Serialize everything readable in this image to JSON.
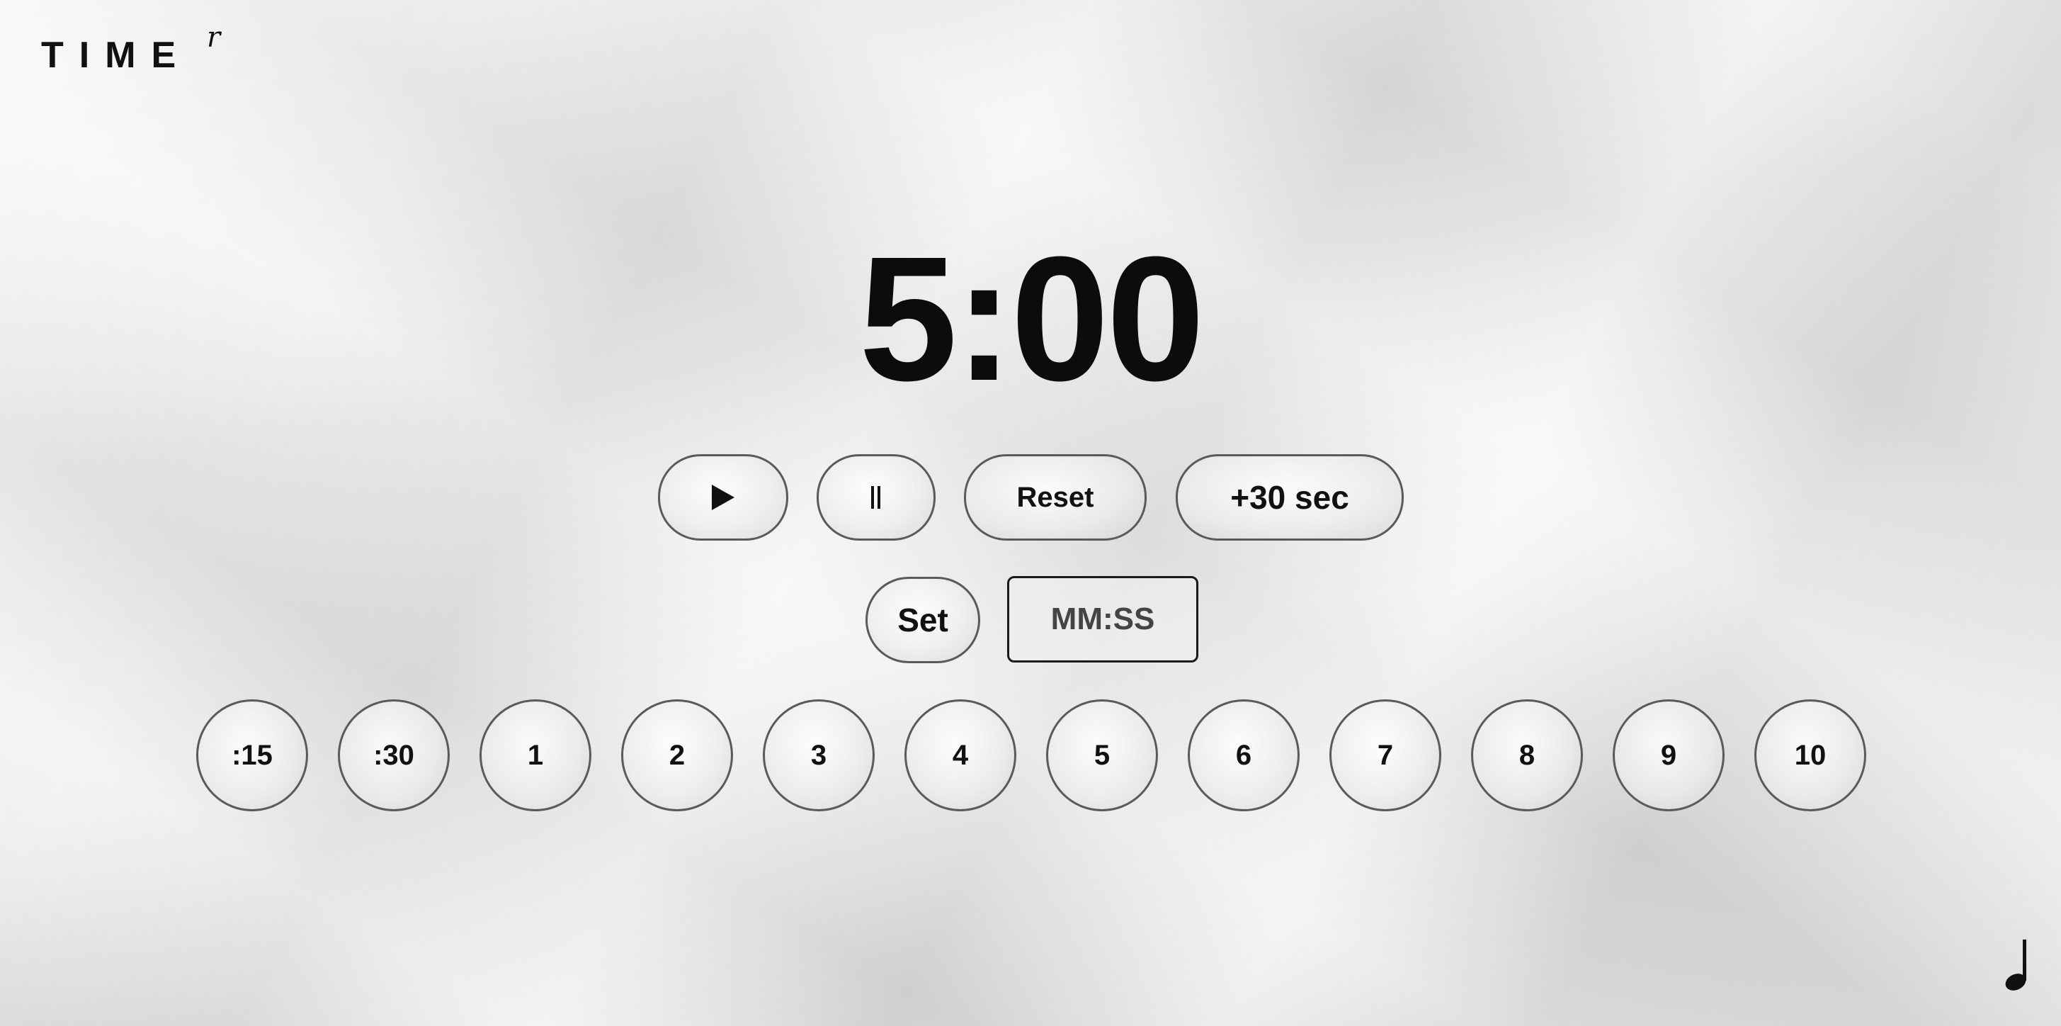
{
  "logo": {
    "main": "TIME",
    "superscript": "r"
  },
  "timer": {
    "display": "5:00"
  },
  "controls": {
    "play_icon": "play-icon",
    "pause_icon": "pause-icon",
    "reset_label": "Reset",
    "add_label": "+30 sec"
  },
  "set_time": {
    "set_label": "Set",
    "input_placeholder": "MM:SS",
    "input_value": ""
  },
  "presets": [
    ":15",
    ":30",
    "1",
    "2",
    "3",
    "4",
    "5",
    "6",
    "7",
    "8",
    "9",
    "10"
  ],
  "footer": {
    "music_icon": "music-note-icon"
  }
}
